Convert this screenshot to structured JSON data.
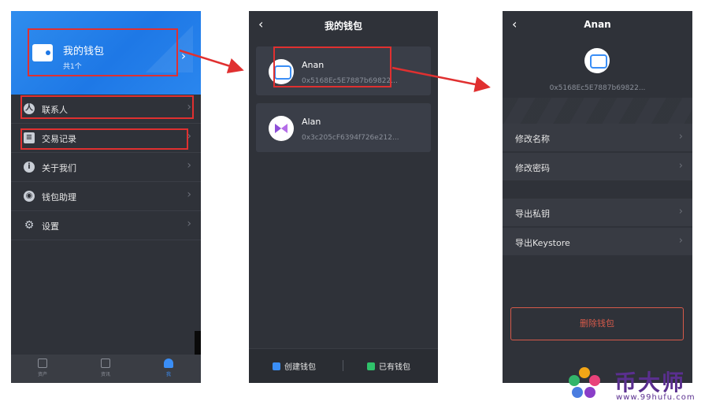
{
  "screen1": {
    "header_title": "我的钱包",
    "header_sub": "共1个",
    "menu": [
      {
        "label": "联系人",
        "icon": "contact-icon"
      },
      {
        "label": "交易记录",
        "icon": "record-icon"
      },
      {
        "label": "关于我们",
        "icon": "info-icon"
      },
      {
        "label": "钱包助理",
        "icon": "assistant-icon"
      },
      {
        "label": "设置",
        "icon": "gear-icon"
      }
    ],
    "tabs": [
      {
        "label": "资产"
      },
      {
        "label": "资讯"
      },
      {
        "label": "我"
      }
    ]
  },
  "screen2": {
    "title": "我的钱包",
    "wallets": [
      {
        "name": "Anan",
        "address": "0x5168Ec5E7887b69822..."
      },
      {
        "name": "Alan",
        "address": "0x3c205cF6394f726e212..."
      }
    ],
    "create_label": "创建钱包",
    "import_label": "已有钱包"
  },
  "screen3": {
    "title": "Anan",
    "address": "0x5168Ec5E7887b69822...",
    "rows_group1": [
      {
        "label": "修改名称"
      },
      {
        "label": "修改密码"
      }
    ],
    "rows_group2": [
      {
        "label": "导出私钥"
      },
      {
        "label": "导出Keystore"
      }
    ],
    "delete_label": "删除钱包"
  },
  "watermark": {
    "text": "币大师",
    "url": "www.99hufu.com"
  },
  "colors": {
    "accent_blue": "#1e78e6",
    "highlight_red": "#e03030",
    "delete_red": "#d65a4a",
    "panel_dark": "#2f3239"
  }
}
